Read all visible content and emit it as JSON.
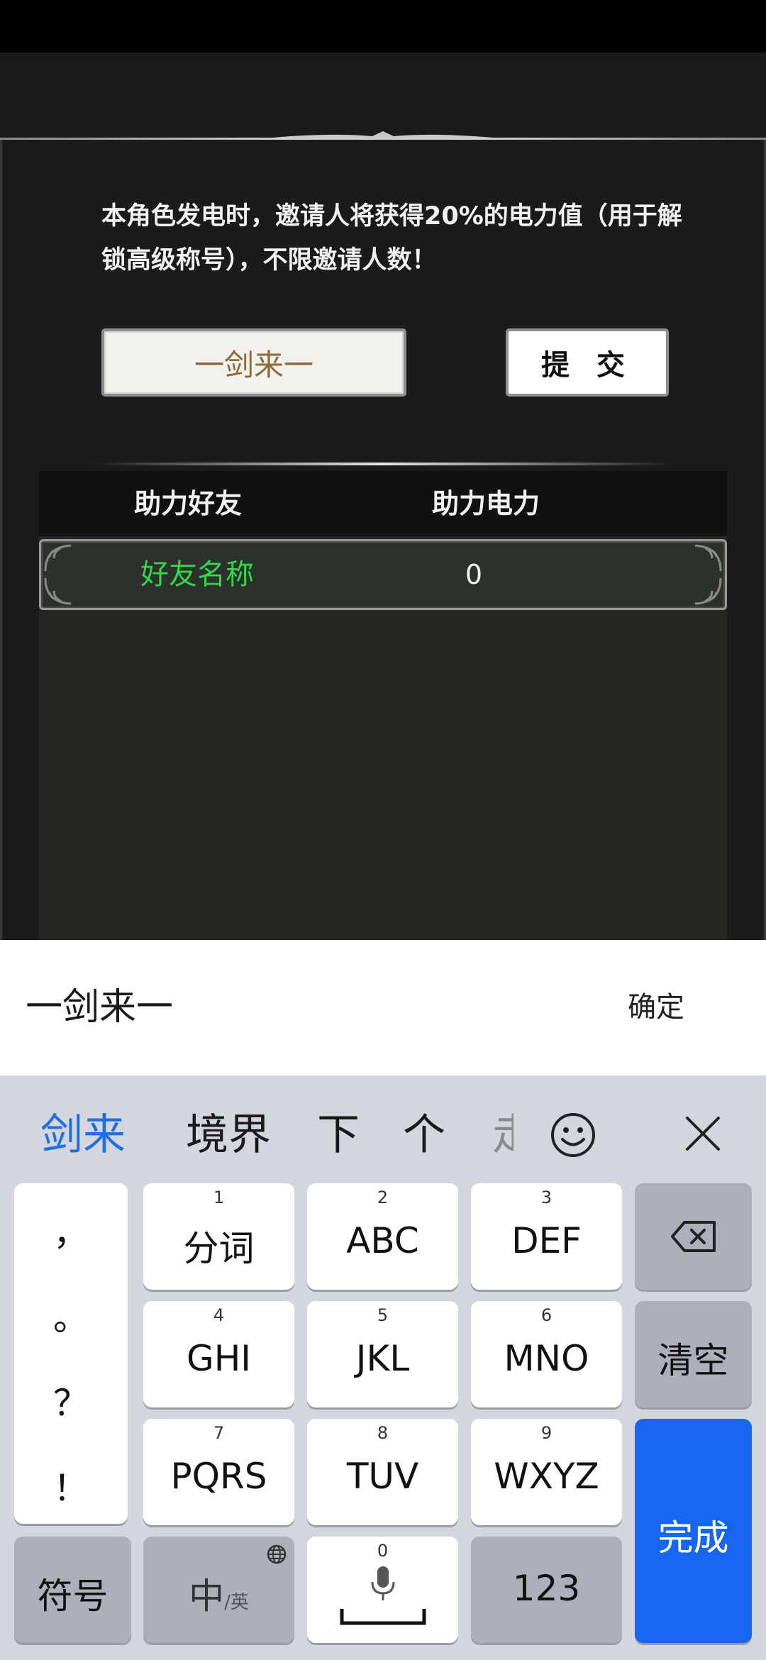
{
  "panel": {
    "description": "本角色发电时，邀请人将获得20%的电力值（用于解锁高级称号），不限邀请人数！",
    "name_input_value": "一剑来一",
    "submit_label": "提 交"
  },
  "table": {
    "headers": [
      "助力好友",
      "助力电力"
    ],
    "rows": [
      {
        "name": "好友名称",
        "power": "0"
      }
    ]
  },
  "input_bar": {
    "text": "一剑来一",
    "confirm_label": "确定"
  },
  "keyboard": {
    "candidates": [
      "剑来",
      "境界",
      "下",
      "个",
      "走"
    ],
    "punctuation": [
      "，",
      "。",
      "？",
      "！"
    ],
    "keys": [
      {
        "num": "1",
        "label": "分词"
      },
      {
        "num": "2",
        "label": "ABC"
      },
      {
        "num": "3",
        "label": "DEF"
      },
      {
        "num": "4",
        "label": "GHI"
      },
      {
        "num": "5",
        "label": "JKL"
      },
      {
        "num": "6",
        "label": "MNO"
      },
      {
        "num": "7",
        "label": "PQRS"
      },
      {
        "num": "8",
        "label": "TUV"
      },
      {
        "num": "9",
        "label": "WXYZ"
      }
    ],
    "clear_label": "清空",
    "done_label": "完成",
    "symbol_label": "符号",
    "lang_label_main": "中",
    "lang_label_sub": "/英",
    "space_num": "0",
    "num_label": "123"
  },
  "colors": {
    "friend_name": "#33d64a",
    "accent_blue": "#1766f0",
    "input_text": "#8a6a3a"
  }
}
